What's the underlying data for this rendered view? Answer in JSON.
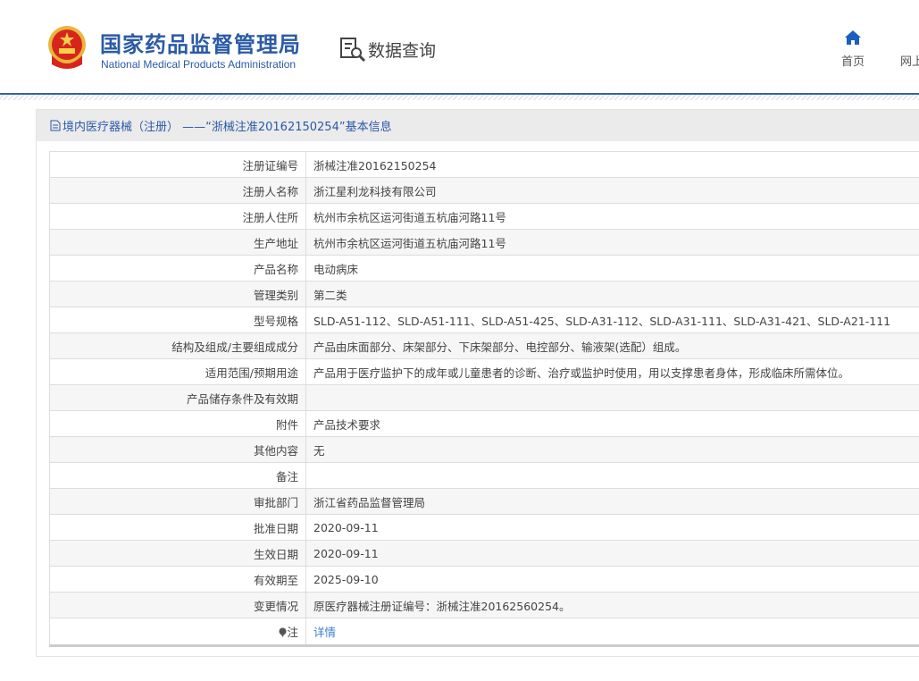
{
  "header": {
    "logo_cn": "国家药品监督管理局",
    "logo_en": "National Medical Products Administration",
    "section_title": "数据查询",
    "nav": [
      {
        "label": "首页",
        "icon": "home-icon"
      },
      {
        "label": "网上"
      }
    ]
  },
  "panel": {
    "title": "境内医疗器械（注册） ——“浙械注准20162150254”基本信息"
  },
  "rows": [
    {
      "label": "注册证编号",
      "value": "浙械注准20162150254"
    },
    {
      "label": "注册人名称",
      "value": "浙江星利龙科技有限公司"
    },
    {
      "label": "注册人住所",
      "value": "杭州市余杭区运河街道五杭庙河路11号"
    },
    {
      "label": "生产地址",
      "value": "杭州市余杭区运河街道五杭庙河路11号"
    },
    {
      "label": "产品名称",
      "value": "电动病床"
    },
    {
      "label": "管理类别",
      "value": "第二类"
    },
    {
      "label": "型号规格",
      "value": "SLD-A51-112、SLD-A51-111、SLD-A51-425、SLD-A31-112、SLD-A31-111、SLD-A31-421、SLD-A21-111"
    },
    {
      "label": "结构及组成/主要组成成分",
      "value": "产品由床面部分、床架部分、下床架部分、电控部分、输液架(选配）组成。"
    },
    {
      "label": "适用范围/预期用途",
      "value": "产品用于医疗监护下的成年或儿童患者的诊断、治疗或监护时使用，用以支撑患者身体，形成临床所需体位。"
    },
    {
      "label": "产品储存条件及有效期",
      "value": ""
    },
    {
      "label": "附件",
      "value": "产品技术要求"
    },
    {
      "label": "其他内容",
      "value": "无"
    },
    {
      "label": "备注",
      "value": ""
    },
    {
      "label": "审批部门",
      "value": "浙江省药品监督管理局"
    },
    {
      "label": "批准日期",
      "value": "2020-09-11"
    },
    {
      "label": "生效日期",
      "value": "2020-09-11"
    },
    {
      "label": "有效期至",
      "value": "2025-09-10"
    },
    {
      "label": "变更情况",
      "value": "原医疗器械注册证编号：浙械注准20162560254。"
    }
  ],
  "note": {
    "label": "注",
    "link": "详情"
  }
}
